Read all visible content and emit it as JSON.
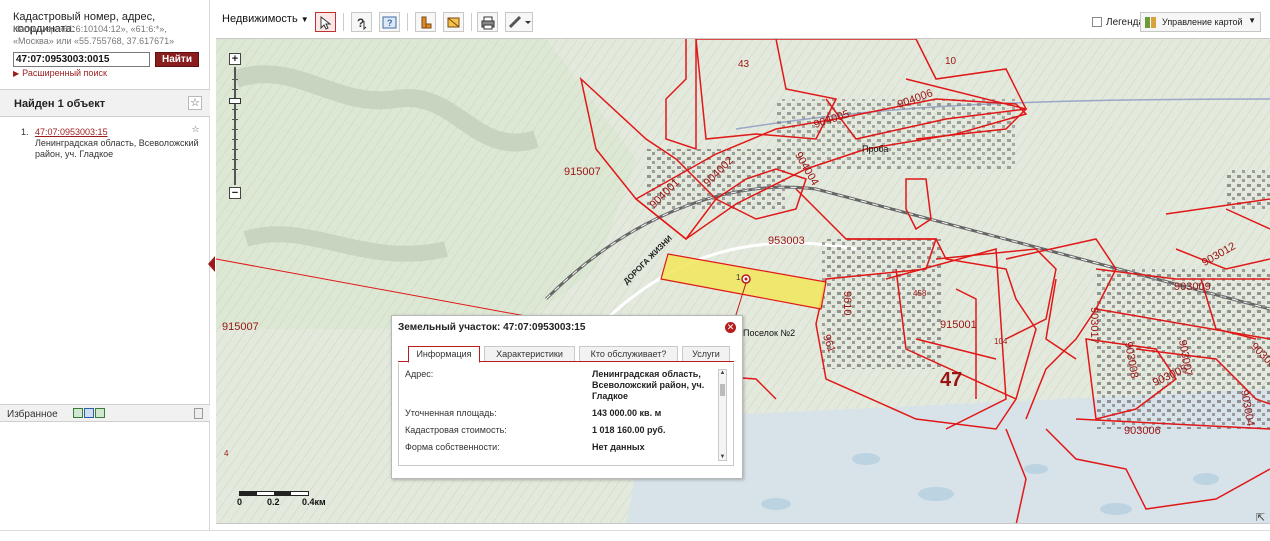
{
  "search": {
    "prompt": "Кадастровый номер, адрес, координата:",
    "example": "Например «61:6:10104:12», «61:6:*», «Москва» или «55.755768, 37.617671»",
    "value": "47:07:0953003:0015",
    "find_button": "Найти",
    "advanced_link": "Расширенный поиск"
  },
  "results": {
    "header": "Найден 1 объект",
    "items": [
      {
        "index": "1.",
        "number": "47:07:0953003:15",
        "address": "Ленинградская область, Всеволожский район, уч. Гладкое"
      }
    ]
  },
  "favorites": {
    "title": "Избранное"
  },
  "toolbar": {
    "layer_select": "Недвижимость",
    "legend_label": "Легенда",
    "map_control_label": "Управление картой"
  },
  "map": {
    "block_labels": [
      "43",
      "10",
      "904006",
      "904005",
      "904004",
      "904002",
      "904001",
      "915007",
      "953003",
      "915007",
      "458",
      "915001",
      "104",
      "47",
      "9610",
      "961",
      "1",
      "903017",
      "903012",
      "903009",
      "903008",
      "903007",
      "903005",
      "903006",
      "903004",
      "903001",
      "4"
    ],
    "town_labels": [
      "Проба",
      "Поселок №2"
    ],
    "road_label": "ДОРОГА ЖИЗНИ",
    "scale": {
      "t0": "0",
      "t1": "0.2",
      "t2": "0.4км"
    },
    "zoom": {
      "plus": "+",
      "minus": "−"
    }
  },
  "popup": {
    "title": "Земельный участок: 47:07:0953003:15",
    "tabs": [
      "Информация",
      "Характеристики",
      "Кто обслуживает?",
      "Услуги"
    ],
    "rows": [
      {
        "key": "Адрес:",
        "value": "Ленинградская область, Всеволожский район, уч. Гладкое"
      },
      {
        "key": "Уточненная площадь:",
        "value": "143 000.00 кв. м"
      },
      {
        "key": "Кадастровая стоимость:",
        "value": "1 018 160.00 руб."
      },
      {
        "key": "Форма собственности:",
        "value": "Нет данных"
      }
    ]
  },
  "colors": {
    "accent": "#9b1b1b",
    "parcel_border": "#e01818",
    "selected_parcel": "#f2e65a",
    "map_bg": "#e6ece0"
  }
}
